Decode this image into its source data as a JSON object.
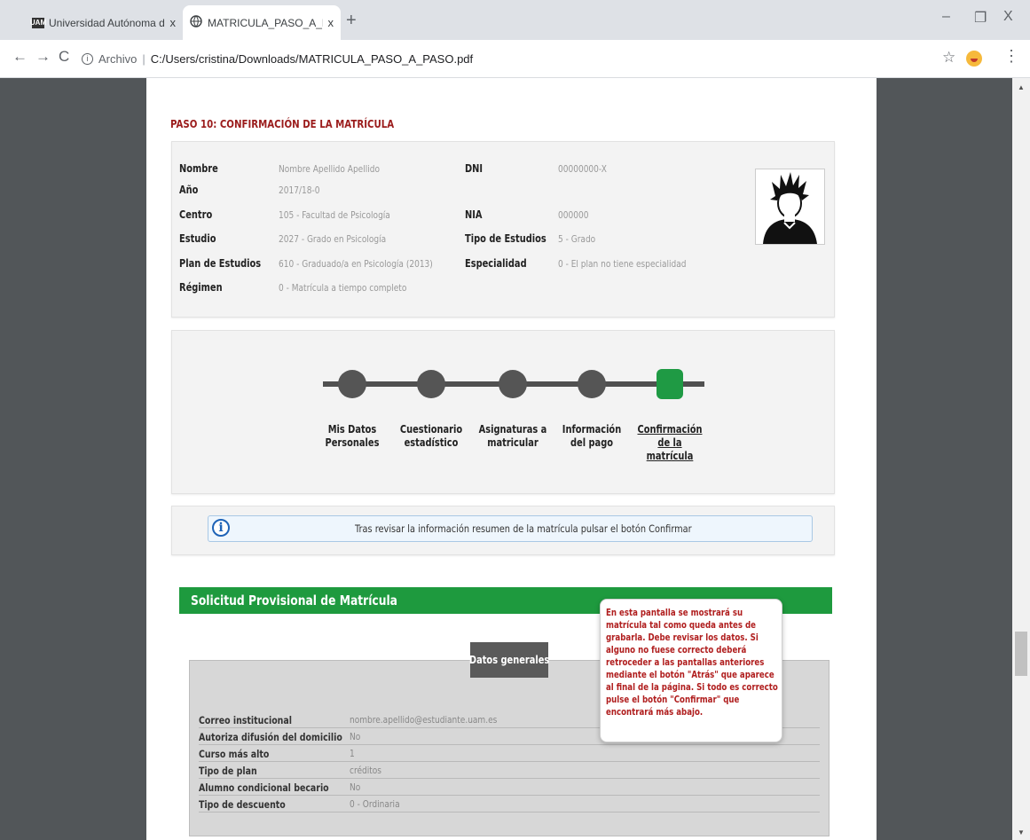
{
  "browser": {
    "tabs": [
      {
        "title": "Universidad Autónoma de Madri",
        "close": "x"
      },
      {
        "title": "MATRICULA_PASO_A_PASO.pdf",
        "close": "x"
      }
    ],
    "favicon_uam": "UAM",
    "new_tab": "+",
    "window_controls": {
      "minimize": "–",
      "maximize": "❐",
      "close": "X"
    },
    "nav": {
      "back": "←",
      "forward": "→",
      "reload": "C"
    },
    "address": {
      "scheme": "Archivo",
      "separator": "|",
      "url": "C:/Users/cristina/Downloads/MATRICULA_PASO_A_PASO.pdf"
    },
    "bookmark": "☆",
    "menu": "⋮"
  },
  "pdf": {
    "step_title": "PASO 10: CONFIRMACIÓN DE LA MATRÍCULA",
    "student_info": {
      "nombre_label": "Nombre",
      "nombre_value": "Nombre Apellido Apellido",
      "anio_label": "Año",
      "anio_value": "2017/18-0",
      "centro_label": "Centro",
      "centro_value": "105 - Facultad de Psicología",
      "estudio_label": "Estudio",
      "estudio_value": "2027 - Grado en Psicología",
      "plan_label": "Plan de Estudios",
      "plan_value": "610 - Graduado/a en Psicología (2013)",
      "regimen_label": "Régimen",
      "regimen_value": "0 - Matrícula a tiempo completo",
      "dni_label": "DNI",
      "dni_value": "00000000-X",
      "nia_label": "NIA",
      "nia_value": "000000",
      "tipo_label": "Tipo de Estudios",
      "tipo_value": "5 - Grado",
      "especialidad_label": "Especialidad",
      "especialidad_value": "0 - El plan no tiene especialidad"
    },
    "progress_steps": [
      {
        "line1": "Mis Datos",
        "line2": "Personales"
      },
      {
        "line1": "Cuestionario",
        "line2": "estadístico"
      },
      {
        "line1": "Asignaturas a",
        "line2": "matricular"
      },
      {
        "line1": "Información",
        "line2": "del pago"
      },
      {
        "line1": "Confirmación",
        "line2": "de la matrícula"
      }
    ],
    "notice": "Tras revisar la información resumen de la matrícula pulsar el botón Confirmar",
    "notice_icon": "i",
    "section_title": "Solicitud Provisional de Matrícula",
    "data_tab": "Datos generales",
    "tooltip": "En esta pantalla se mostrará su matrícula tal como queda antes de grabarla. Debe revisar los datos. Si alguno no fuese correcto deberá retroceder a las pantallas anteriores mediante el botón \"Atrás\" que aparece al final de la página. Si todo es correcto pulse el botón \"Confirmar\" que encontrará más abajo.",
    "data_rows": [
      {
        "label": "Correo institucional",
        "value": "nombre.apellido@estudiante.uam.es"
      },
      {
        "label": "Autoriza difusión del domicilio",
        "value": "No"
      },
      {
        "label": "Curso más alto",
        "value": "1"
      },
      {
        "label": "Tipo de plan",
        "value": "créditos"
      },
      {
        "label": "Alumno condicional becario",
        "value": "No"
      },
      {
        "label": "Tipo de descuento",
        "value": "0 - Ordinaria"
      }
    ]
  },
  "colors": {
    "accent_green": "#1e9a3e",
    "title_red": "#9b1c1c",
    "tooltip_red": "#b01e1e"
  }
}
